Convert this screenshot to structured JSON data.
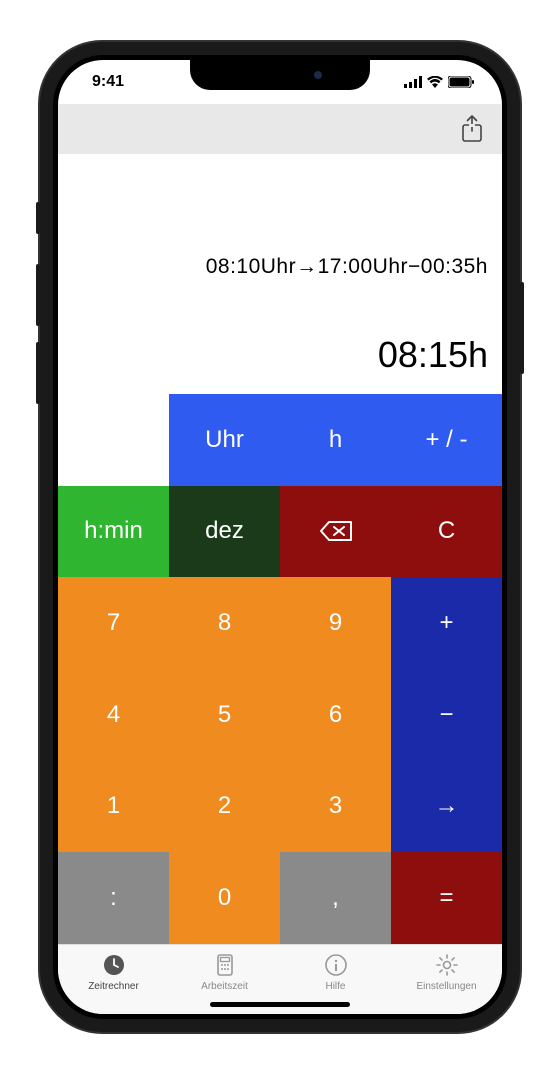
{
  "status": {
    "time": "9:41"
  },
  "display": {
    "expression": "08:10Uhr→17:00Uhr−00:35h",
    "result": "08:15h"
  },
  "keys": {
    "uhr": "Uhr",
    "h": "h",
    "plusminus": "+ / -",
    "hmin": "h:min",
    "dez": "dez",
    "clear": "C",
    "k7": "7",
    "k8": "8",
    "k9": "9",
    "plus": "+",
    "k4": "4",
    "k5": "5",
    "k6": "6",
    "minus": "−",
    "k1": "1",
    "k2": "2",
    "k3": "3",
    "arrow": "→",
    "colon": ":",
    "k0": "0",
    "comma": ",",
    "equals": "="
  },
  "tabs": {
    "t1": "Zeitrechner",
    "t2": "Arbeitszeit",
    "t3": "Hilfe",
    "t4": "Einstellungen"
  }
}
